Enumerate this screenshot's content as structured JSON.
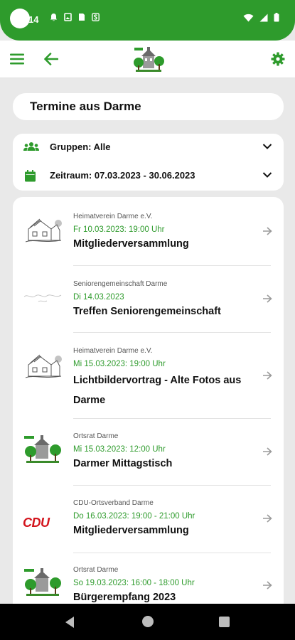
{
  "status": {
    "time": "14",
    "accent": "#2e9b2c"
  },
  "appbar": {
    "menu_icon": "menu-icon",
    "back_icon": "arrow-left-icon",
    "settings_icon": "gear-icon"
  },
  "page": {
    "title": "Termine aus Darme"
  },
  "filters": {
    "groups_label": "Gruppen: Alle",
    "period_label": "Zeitraum: 07.03.2023 - 30.06.2023"
  },
  "events": [
    {
      "group": "Heimatverein Darme e.V.",
      "date": "Fr 10.03.2023: 19:00 Uhr",
      "title": "Mitgliederversammlung",
      "thumb": "house-sketch"
    },
    {
      "group": "Seniorengemeinschaft Darme",
      "date": "Di 14.03.2023",
      "title": "Treffen Seniorengemeinschaft",
      "thumb": "script-logo"
    },
    {
      "group": "Heimatverein Darme e.V.",
      "date": "Mi 15.03.2023: 19:00 Uhr",
      "title": "Lichtbildervortrag - Alte Fotos aus Darme",
      "thumb": "house-sketch"
    },
    {
      "group": "Ortsrat Darme",
      "date": "Mi 15.03.2023: 12:00 Uhr",
      "title": "Darmer Mittagstisch",
      "thumb": "darme-logo"
    },
    {
      "group": "CDU-Ortsverband Darme",
      "date": "Do 16.03.2023: 19:00 - 21:00 Uhr",
      "title": "Mitgliederversammlung",
      "thumb": "cdu-logo",
      "thumb_text": "CDU"
    },
    {
      "group": "Ortsrat Darme",
      "date": "So 19.03.2023: 16:00 - 18:00 Uhr",
      "title": "Bürgerempfang 2023",
      "thumb": "darme-logo"
    }
  ]
}
